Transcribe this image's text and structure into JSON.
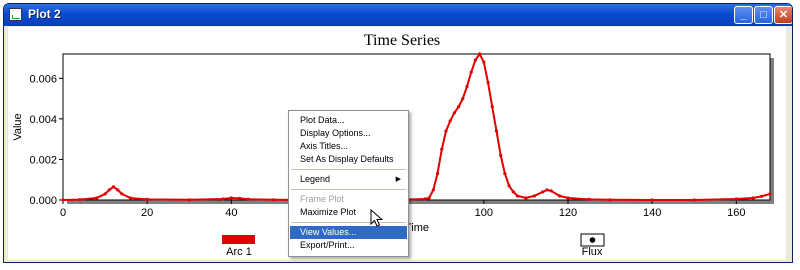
{
  "window": {
    "title": "Plot 2"
  },
  "titlebar_buttons": {
    "minimize": "_",
    "maximize": "□",
    "close": "✕"
  },
  "chart_data": {
    "type": "line",
    "title": "Time Series",
    "xlabel": "Time",
    "ylabel": "Value",
    "xlim": [
      0,
      168
    ],
    "ylim": [
      0,
      0.0072
    ],
    "x_ticks": [
      0,
      20,
      40,
      60,
      80,
      100,
      120,
      140,
      160
    ],
    "y_ticks": [
      0,
      0.002,
      0.004,
      0.006
    ],
    "x_tick_labels": [
      "0",
      "20",
      "40",
      "60",
      "80",
      "100",
      "120",
      "140",
      "160"
    ],
    "y_tick_labels": [
      "0.000",
      "0.002",
      "0.004",
      "0.006"
    ],
    "grid": false,
    "series": [
      {
        "name": "Arc 1",
        "color": "#e00000",
        "x": [
          0,
          4,
          8,
          10,
          11,
          12,
          13,
          14,
          16,
          20,
          30,
          38,
          40,
          42,
          44,
          50,
          60,
          70,
          80,
          86,
          87,
          88,
          89,
          90,
          91,
          92,
          93,
          94,
          95,
          96,
          97,
          98,
          99,
          100,
          101,
          102,
          103,
          104,
          105,
          106,
          107,
          108,
          110,
          112,
          114,
          115,
          116,
          118,
          120,
          125,
          130,
          140,
          150,
          160,
          164,
          166,
          168
        ],
        "y": [
          0,
          2e-05,
          0.0001,
          0.0003,
          0.0005,
          0.00065,
          0.0005,
          0.0003,
          0.0001,
          3e-05,
          1e-05,
          5e-05,
          0.0001,
          8e-05,
          4e-05,
          1e-05,
          0,
          0,
          1e-05,
          5e-05,
          0.0001,
          0.0005,
          0.0013,
          0.0025,
          0.0034,
          0.0039,
          0.0043,
          0.0046,
          0.005,
          0.0056,
          0.0063,
          0.0069,
          0.0074,
          0.0068,
          0.0058,
          0.0046,
          0.0034,
          0.0022,
          0.0013,
          0.0007,
          0.0004,
          0.0002,
          0.0001,
          0.0002,
          0.0004,
          0.0005,
          0.00045,
          0.0002,
          0.0001,
          3e-05,
          1e-05,
          0,
          0,
          5e-05,
          0.0001,
          0.00018,
          0.0003
        ]
      }
    ],
    "legend": [
      {
        "label": "Arc 1",
        "swatch": "red-bar"
      },
      {
        "label": "Flux",
        "swatch": "black-dot"
      }
    ]
  },
  "context_menu": {
    "items": [
      {
        "label": "Plot Data...",
        "enabled": true
      },
      {
        "label": "Display Options...",
        "enabled": true
      },
      {
        "label": "Axis Titles...",
        "enabled": true
      },
      {
        "label": "Set As Display Defaults",
        "enabled": true
      },
      {
        "label": "Legend",
        "enabled": true,
        "submenu": true
      },
      {
        "label": "Frame Plot",
        "enabled": false
      },
      {
        "label": "Maximize Plot",
        "enabled": true
      },
      {
        "label": "View Values...",
        "enabled": true,
        "highlighted": true
      },
      {
        "label": "Export/Print...",
        "enabled": true
      }
    ]
  }
}
